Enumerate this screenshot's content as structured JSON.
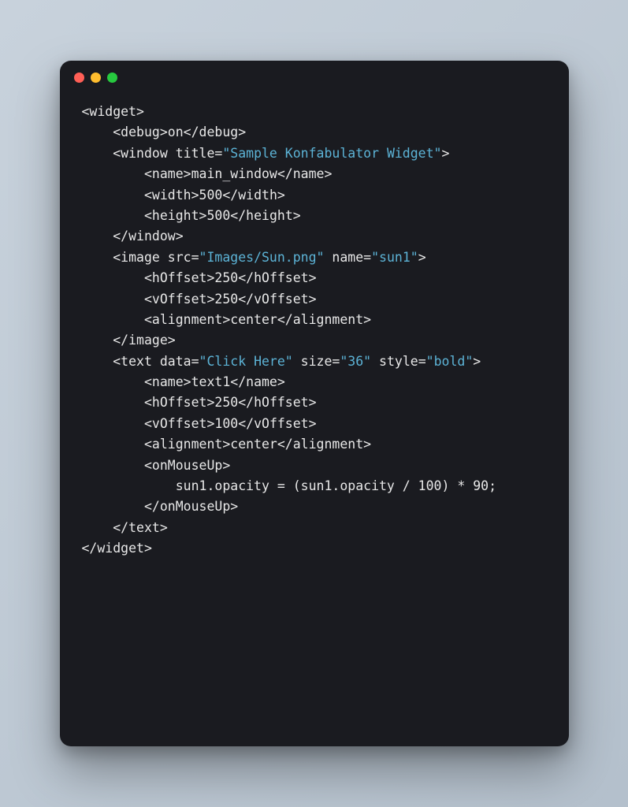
{
  "window": {
    "traffic_lights": {
      "close_color": "#ff5f56",
      "minimize_color": "#ffbd2e",
      "zoom_color": "#27c93f"
    }
  },
  "syntax_colors": {
    "default": "#e8e8e8",
    "string": "#5cb3d6",
    "background": "#1a1b20"
  },
  "code": {
    "lines": [
      {
        "indent": 0,
        "segments": [
          {
            "t": "tag",
            "v": "<widget>"
          }
        ]
      },
      {
        "indent": 1,
        "segments": [
          {
            "t": "tag",
            "v": "<debug>"
          },
          {
            "t": "txt",
            "v": "on"
          },
          {
            "t": "tag",
            "v": "</debug>"
          }
        ]
      },
      {
        "indent": 1,
        "segments": [
          {
            "t": "tag",
            "v": "<window title="
          },
          {
            "t": "str",
            "v": "\"Sample Konfabulator Widget\""
          },
          {
            "t": "tag",
            "v": ">"
          }
        ]
      },
      {
        "indent": 2,
        "segments": [
          {
            "t": "tag",
            "v": "<name>"
          },
          {
            "t": "txt",
            "v": "main_window"
          },
          {
            "t": "tag",
            "v": "</name>"
          }
        ]
      },
      {
        "indent": 2,
        "segments": [
          {
            "t": "tag",
            "v": "<width>"
          },
          {
            "t": "txt",
            "v": "500"
          },
          {
            "t": "tag",
            "v": "</width>"
          }
        ]
      },
      {
        "indent": 2,
        "segments": [
          {
            "t": "tag",
            "v": "<height>"
          },
          {
            "t": "txt",
            "v": "500"
          },
          {
            "t": "tag",
            "v": "</height>"
          }
        ]
      },
      {
        "indent": 1,
        "segments": [
          {
            "t": "tag",
            "v": "</window>"
          }
        ]
      },
      {
        "indent": 1,
        "segments": [
          {
            "t": "tag",
            "v": "<image src="
          },
          {
            "t": "str",
            "v": "\"Images/Sun.png\""
          },
          {
            "t": "tag",
            "v": " name="
          },
          {
            "t": "str",
            "v": "\"sun1\""
          },
          {
            "t": "tag",
            "v": ">"
          }
        ]
      },
      {
        "indent": 2,
        "segments": [
          {
            "t": "tag",
            "v": "<hOffset>"
          },
          {
            "t": "txt",
            "v": "250"
          },
          {
            "t": "tag",
            "v": "</hOffset>"
          }
        ]
      },
      {
        "indent": 2,
        "segments": [
          {
            "t": "tag",
            "v": "<vOffset>"
          },
          {
            "t": "txt",
            "v": "250"
          },
          {
            "t": "tag",
            "v": "</vOffset>"
          }
        ]
      },
      {
        "indent": 2,
        "segments": [
          {
            "t": "tag",
            "v": "<alignment>"
          },
          {
            "t": "txt",
            "v": "center"
          },
          {
            "t": "tag",
            "v": "</alignment>"
          }
        ]
      },
      {
        "indent": 1,
        "segments": [
          {
            "t": "tag",
            "v": "</image>"
          }
        ]
      },
      {
        "indent": 1,
        "segments": [
          {
            "t": "tag",
            "v": "<text data="
          },
          {
            "t": "str",
            "v": "\"Click Here\""
          },
          {
            "t": "tag",
            "v": " size="
          },
          {
            "t": "str",
            "v": "\"36\""
          },
          {
            "t": "tag",
            "v": " style="
          },
          {
            "t": "str",
            "v": "\"bold\""
          },
          {
            "t": "tag",
            "v": ">"
          }
        ]
      },
      {
        "indent": 2,
        "segments": [
          {
            "t": "tag",
            "v": "<name>"
          },
          {
            "t": "txt",
            "v": "text1"
          },
          {
            "t": "tag",
            "v": "</name>"
          }
        ]
      },
      {
        "indent": 2,
        "segments": [
          {
            "t": "tag",
            "v": "<hOffset>"
          },
          {
            "t": "txt",
            "v": "250"
          },
          {
            "t": "tag",
            "v": "</hOffset>"
          }
        ]
      },
      {
        "indent": 2,
        "segments": [
          {
            "t": "tag",
            "v": "<vOffset>"
          },
          {
            "t": "txt",
            "v": "100"
          },
          {
            "t": "tag",
            "v": "</vOffset>"
          }
        ]
      },
      {
        "indent": 2,
        "segments": [
          {
            "t": "tag",
            "v": "<alignment>"
          },
          {
            "t": "txt",
            "v": "center"
          },
          {
            "t": "tag",
            "v": "</alignment>"
          }
        ]
      },
      {
        "indent": 2,
        "segments": [
          {
            "t": "tag",
            "v": "<onMouseUp>"
          }
        ]
      },
      {
        "indent": 3,
        "segments": [
          {
            "t": "txt",
            "v": "sun1.opacity = (sun1.opacity / 100) * 90;"
          }
        ]
      },
      {
        "indent": 2,
        "segments": [
          {
            "t": "tag",
            "v": "</onMouseUp>"
          }
        ]
      },
      {
        "indent": 1,
        "segments": [
          {
            "t": "tag",
            "v": "</text>"
          }
        ]
      },
      {
        "indent": 0,
        "segments": [
          {
            "t": "tag",
            "v": "</widget>"
          }
        ]
      }
    ],
    "indent_unit": "    "
  }
}
